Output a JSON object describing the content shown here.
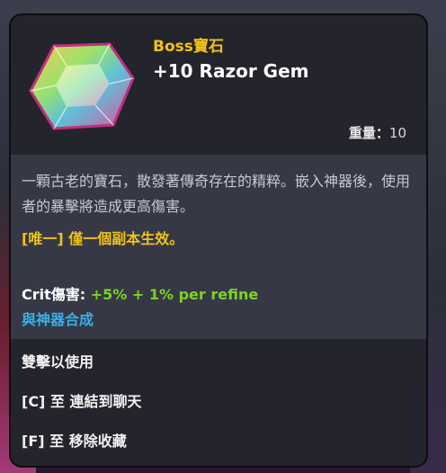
{
  "item": {
    "category": "Boss寶石",
    "name": "+10 Razor Gem",
    "weight_label": "重量：",
    "weight_value": "10",
    "description": "一顆古老的寶石，散發著傳奇存在的精粹。嵌入神器後，使用者的暴擊將造成更高傷害。",
    "unique_note": "[唯一] 僅一個副本生效。",
    "stat_label": "Crit傷害: ",
    "stat_value": "+5% + 1% per refine",
    "synthesis": "與神器合成"
  },
  "actions": [
    "雙擊以使用",
    "[C] 至 連結到聊天",
    "[F] 至 移除收藏"
  ],
  "colors": {
    "category": "#f0c21c",
    "unique": "#f0c21c",
    "stat_value": "#7ed321",
    "synthesis": "#3ab0e8"
  },
  "icon": "rainbow-gem-icon"
}
